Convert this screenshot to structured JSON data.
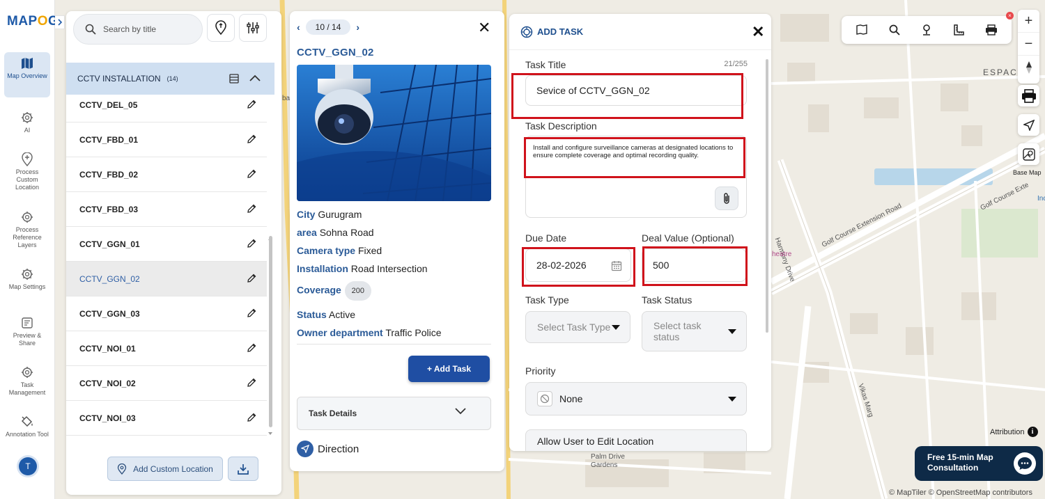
{
  "app": {
    "logo_text_a": "MAP",
    "logo_text_b": "O",
    "logo_text_c": "G"
  },
  "nav": [
    {
      "label": "Map Overview",
      "icon": "map-icon"
    },
    {
      "label": "AI",
      "icon": "ai-gear-icon"
    },
    {
      "label": "Process Custom Location",
      "icon": "location-plus-icon"
    },
    {
      "label": "Process Reference Layers",
      "icon": "layers-gear-icon"
    },
    {
      "label": "Map Settings",
      "icon": "gear-icon"
    },
    {
      "label": "Preview & Share",
      "icon": "preview-icon"
    },
    {
      "label": "Task Management",
      "icon": "task-gear-icon"
    },
    {
      "label": "Annotation Tool",
      "icon": "paint-bucket-icon"
    }
  ],
  "user": {
    "initial": "T"
  },
  "layer_panel": {
    "search_placeholder": "Search by title",
    "layer_name": "CCTV INSTALLATION",
    "layer_count": "(14)",
    "items": [
      "CCTV_DEL_05",
      "CCTV_FBD_01",
      "CCTV_FBD_02",
      "CCTV_FBD_03",
      "CCTV_GGN_01",
      "CCTV_GGN_02",
      "CCTV_GGN_03",
      "CCTV_NOI_01",
      "CCTV_NOI_02",
      "CCTV_NOI_03"
    ],
    "selected_item": "CCTV_GGN_02",
    "add_custom_location": "Add Custom Location"
  },
  "detail": {
    "pager": "10 / 14",
    "title": "CCTV_GGN_02",
    "attributes": {
      "city_key": "City",
      "city_val": "Gurugram",
      "area_key": "area",
      "area_val": "Sohna Road",
      "camera_key": "Camera type",
      "camera_val": "Fixed",
      "install_key": "Installation",
      "install_val": "Road Intersection",
      "coverage_key": "Coverage",
      "coverage_val": "200",
      "status_key": "Status",
      "status_val": "Active",
      "owner_key": "Owner department",
      "owner_val": "Traffic Police"
    },
    "add_task_btn": "+ Add Task",
    "task_details": "Task Details",
    "direction": "Direction"
  },
  "add_task": {
    "header": "ADD TASK",
    "title_label": "Task Title",
    "title_counter": "21/255",
    "title_value": "Sevice of CCTV_GGN_02",
    "description_label": "Task Description",
    "description_value": "Install and configure surveillance cameras at designated locations to ensure complete coverage and optimal recording quality.",
    "due_date_label": "Due Date",
    "due_date_value": "28-02-2026",
    "deal_label": "Deal Value (Optional)",
    "deal_value": "500",
    "task_type_label": "Task Type",
    "task_type_placeholder": "Select Task Type",
    "task_status_label": "Task Status",
    "task_status_placeholder": "Select task status",
    "priority_label": "Priority",
    "priority_value": "None",
    "allow_edit_label": "Allow User to Edit Location"
  },
  "map": {
    "labels": {
      "golf_course_ext_1": "Golf Course Extension Road",
      "golf_course_ext_2": "Golf Course Exte",
      "harmony_drive": "Harmony Drive",
      "vikas_marg": "Vikas Marg",
      "palm_drive": "Palm Drive Gardens",
      "espace": "ESPAC",
      "theatre": "heatre",
      "base_map": "Base Map",
      "ba": "ba",
      "inc": "Inc"
    },
    "attribution": "Attribution",
    "copyright": "© MapTiler © OpenStreetMap contributors",
    "consult_line1": "Free 15-min Map",
    "consult_line2": "Consultation",
    "notification_badge": "×"
  },
  "colors": {
    "brand": "#1e5aa8",
    "accent": "#f0a500",
    "highlight": "#d0121b",
    "primary_btn": "#1f4ea3"
  }
}
